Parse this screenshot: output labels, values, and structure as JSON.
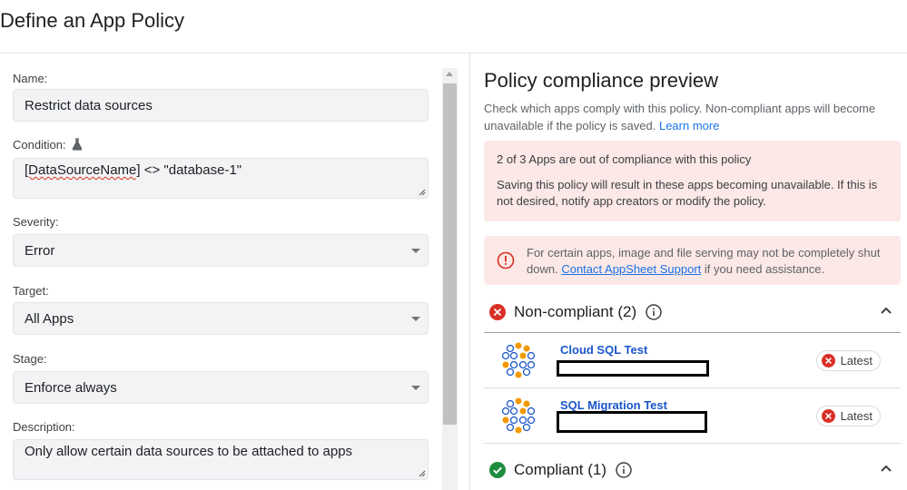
{
  "page": {
    "title": "Define an App Policy"
  },
  "form": {
    "name_label": "Name:",
    "name_value": "Restrict data sources",
    "condition_label": "Condition:",
    "condition_part1": "[DataSourceName]",
    "condition_part2": " <> \"database-1\"",
    "severity_label": "Severity:",
    "severity_value": "Error",
    "target_label": "Target:",
    "target_value": "All Apps",
    "stage_label": "Stage:",
    "stage_value": "Enforce always",
    "description_label": "Description:",
    "description_value": "Only allow certain data sources to be attached to apps"
  },
  "preview": {
    "title": "Policy compliance preview",
    "desc": "Check which apps comply with this policy. Non-compliant apps will become unavailable if the policy is saved.",
    "learn_more": "Learn more",
    "alert_title": "2 of 3 Apps are out of compliance with this policy",
    "alert_body": "Saving this policy will result in these apps becoming unavailable. If this is not desired, notify app creators or modify the policy.",
    "warn_prefix": "For certain apps, image and file serving may not be completely shut down.",
    "warn_link": "Contact AppSheet Support",
    "warn_suffix": " if you need assistance.",
    "noncompliant_label": "Non-compliant (2)",
    "compliant_label": "Compliant (1)",
    "apps": [
      {
        "name": "Cloud SQL Test",
        "badge": "Latest"
      },
      {
        "name": "SQL Migration Test",
        "badge": "Latest"
      }
    ]
  },
  "colors": {
    "error_red": "#d93025",
    "success_green": "#1e8e3e",
    "link_blue": "#1a73e8",
    "alert_bg": "#fce8e6"
  }
}
